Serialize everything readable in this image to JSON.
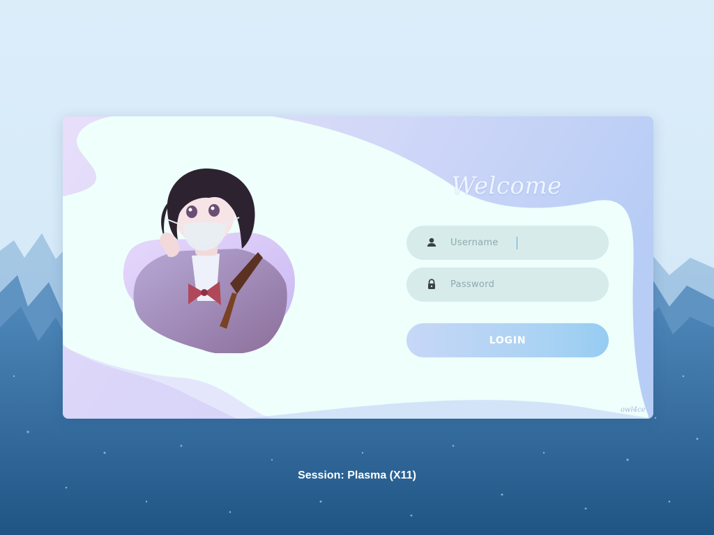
{
  "login": {
    "welcome_text": "Welcome",
    "username_placeholder": "Username",
    "username_value": "",
    "password_placeholder": "Password",
    "password_value": "",
    "login_label": "LOGIN",
    "user_icon": "user-icon",
    "lock_icon": "lock-icon",
    "signature": "owl4ce"
  },
  "session": {
    "label": "Session: Plasma (X11)"
  },
  "colors": {
    "background_sky": "#dbeefa",
    "card_blob": "#eefffc",
    "card_gradient_start": "#e6ddfa",
    "card_gradient_end": "#b9cef5",
    "input_fill": "#d7ebea",
    "login_gradient_start": "#c7d7f7",
    "login_gradient_end": "#96ccf2"
  }
}
